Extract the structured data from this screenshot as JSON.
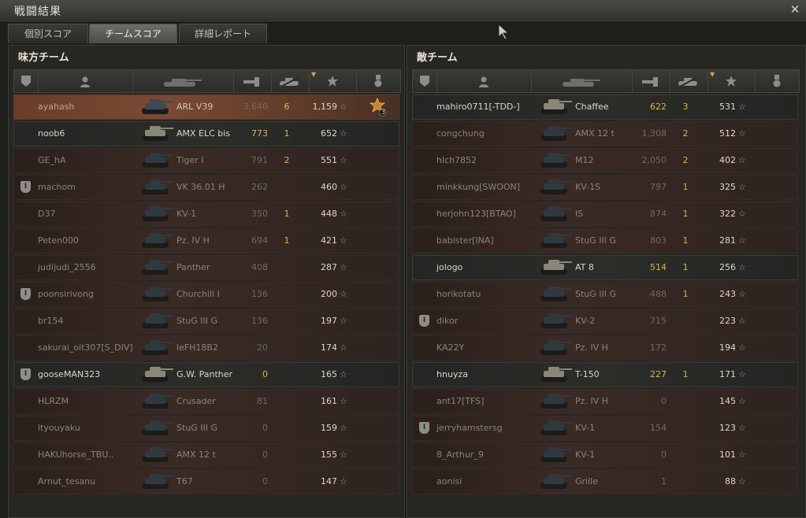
{
  "window": {
    "title": "戦闘結果"
  },
  "tabs": [
    {
      "label": "個別スコア"
    },
    {
      "label": "チームスコア"
    },
    {
      "label": "詳細レポート"
    }
  ],
  "header_icons": [
    "squad-icon",
    "player-icon",
    "tank-icon",
    "damage-icon",
    "kills-icon",
    "xp-icon",
    "medal-icon"
  ],
  "allies": {
    "title": "味方チーム",
    "rows": [
      {
        "name": "ayahash",
        "tank": "ARL V39",
        "dmg": "3,640",
        "kills": "6",
        "xp": "1,159",
        "state": "player",
        "squad": false,
        "medal": "3"
      },
      {
        "name": "noob6",
        "tank": "AMX ELC bis",
        "dmg": "773",
        "kills": "1",
        "xp": "652",
        "state": "alive",
        "squad": false
      },
      {
        "name": "GE_hA",
        "tank": "Tiger I",
        "dmg": "791",
        "kills": "2",
        "xp": "551",
        "state": "dead",
        "squad": false
      },
      {
        "name": "machom",
        "tank": "VK 36.01 H",
        "dmg": "262",
        "kills": "",
        "xp": "460",
        "state": "dead",
        "squad": true
      },
      {
        "name": "D37",
        "tank": "KV-1",
        "dmg": "350",
        "kills": "1",
        "xp": "448",
        "state": "dead",
        "squad": false
      },
      {
        "name": "Peten000",
        "tank": "Pz. IV H",
        "dmg": "694",
        "kills": "1",
        "xp": "421",
        "state": "dead",
        "squad": false
      },
      {
        "name": "judijudi_2556",
        "tank": "Panther",
        "dmg": "408",
        "kills": "",
        "xp": "287",
        "state": "dead",
        "squad": false
      },
      {
        "name": "poonsirivong",
        "tank": "Churchill I",
        "dmg": "136",
        "kills": "",
        "xp": "200",
        "state": "dead",
        "squad": true
      },
      {
        "name": "br154",
        "tank": "StuG III G",
        "dmg": "136",
        "kills": "",
        "xp": "197",
        "state": "dead",
        "squad": false
      },
      {
        "name": "sakurai_oit307[S_DIV]",
        "tank": "leFH18B2",
        "dmg": "20",
        "kills": "",
        "xp": "174",
        "state": "dead",
        "squad": false
      },
      {
        "name": "gooseMAN323",
        "tank": "G.W. Panther",
        "dmg": "0",
        "kills": "",
        "xp": "165",
        "state": "alive",
        "squad": true
      },
      {
        "name": "HLRZM",
        "tank": "Crusader",
        "dmg": "81",
        "kills": "",
        "xp": "161",
        "state": "dead",
        "squad": false
      },
      {
        "name": "ityouyaku",
        "tank": "StuG III G",
        "dmg": "0",
        "kills": "",
        "xp": "159",
        "state": "dead",
        "squad": false
      },
      {
        "name": "HAKUhorse_TBU..",
        "tank": "AMX 12 t",
        "dmg": "0",
        "kills": "",
        "xp": "155",
        "state": "dead",
        "squad": false
      },
      {
        "name": "Arnut_tesanu",
        "tank": "T67",
        "dmg": "0",
        "kills": "",
        "xp": "147",
        "state": "dead",
        "squad": false
      }
    ]
  },
  "enemies": {
    "title": "敵チーム",
    "rows": [
      {
        "name": "mahiro0711[-TDD-]",
        "tank": "Chaffee",
        "dmg": "622",
        "kills": "3",
        "xp": "531",
        "state": "alive",
        "squad": false
      },
      {
        "name": "congchung",
        "tank": "AMX 12 t",
        "dmg": "1,308",
        "kills": "2",
        "xp": "512",
        "state": "dead",
        "squad": false
      },
      {
        "name": "hlch7852",
        "tank": "M12",
        "dmg": "2,050",
        "kills": "2",
        "xp": "402",
        "state": "dead",
        "squad": false
      },
      {
        "name": "minkkung[SWOON]",
        "tank": "KV-1S",
        "dmg": "797",
        "kills": "1",
        "xp": "325",
        "state": "dead",
        "squad": false
      },
      {
        "name": "herjohn123[BTAO]",
        "tank": "IS",
        "dmg": "874",
        "kills": "1",
        "xp": "322",
        "state": "dead",
        "squad": false
      },
      {
        "name": "babister[INA]",
        "tank": "StuG III G",
        "dmg": "803",
        "kills": "1",
        "xp": "281",
        "state": "dead",
        "squad": false
      },
      {
        "name": "jologo",
        "tank": "AT 8",
        "dmg": "514",
        "kills": "1",
        "xp": "256",
        "state": "alive",
        "squad": false
      },
      {
        "name": "horikotatu",
        "tank": "StuG III G",
        "dmg": "488",
        "kills": "1",
        "xp": "243",
        "state": "dead",
        "squad": false
      },
      {
        "name": "dikor",
        "tank": "KV-2",
        "dmg": "715",
        "kills": "",
        "xp": "223",
        "state": "dead",
        "squad": true
      },
      {
        "name": "KA22Y",
        "tank": "Pz. IV H",
        "dmg": "172",
        "kills": "",
        "xp": "194",
        "state": "dead",
        "squad": false
      },
      {
        "name": "hnuyza",
        "tank": "T-150",
        "dmg": "227",
        "kills": "1",
        "xp": "171",
        "state": "alive",
        "squad": false
      },
      {
        "name": "ant17[TFS]",
        "tank": "Pz. IV H",
        "dmg": "0",
        "kills": "",
        "xp": "145",
        "state": "dead",
        "squad": false
      },
      {
        "name": "jerryhamstersg",
        "tank": "KV-1",
        "dmg": "154",
        "kills": "",
        "xp": "123",
        "state": "dead",
        "squad": true
      },
      {
        "name": "8_Arthur_9",
        "tank": "KV-1",
        "dmg": "0",
        "kills": "",
        "xp": "101",
        "state": "dead",
        "squad": false
      },
      {
        "name": "aonisi",
        "tank": "Grille",
        "dmg": "1",
        "kills": "",
        "xp": "88",
        "state": "dead",
        "squad": false
      }
    ]
  },
  "colors": {
    "alive_damage": "#d2b84a",
    "player_row": "#7a4a33",
    "dead_row": "#3a2a25"
  }
}
